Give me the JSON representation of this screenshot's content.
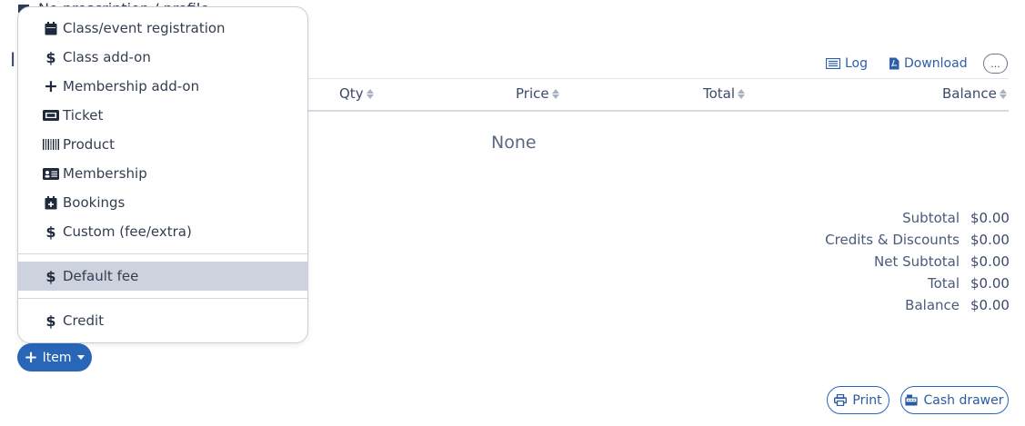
{
  "page": {
    "partial_top_text": "No prescription / profile",
    "heading_partial": "I",
    "links": {
      "log": "Log",
      "download": "Download",
      "more": "..."
    },
    "table": {
      "columns": [
        "Qty",
        "Price",
        "Total",
        "Balance"
      ],
      "empty_text": "None"
    },
    "summary": [
      {
        "label": "Subtotal",
        "value": "$0.00"
      },
      {
        "label": "Credits & Discounts",
        "value": "$0.00"
      },
      {
        "label": "Net Subtotal",
        "value": "$0.00"
      },
      {
        "label": "Total",
        "value": "$0.00"
      },
      {
        "label": "Balance",
        "value": "$0.00"
      }
    ],
    "item_button": "Item",
    "print_button": "Print",
    "cash_drawer_button": "Cash drawer"
  },
  "menu": {
    "items": [
      {
        "label": "Class/event registration",
        "icon": "calendar-icon"
      },
      {
        "label": "Class add-on",
        "icon": "dollar-icon"
      },
      {
        "label": "Membership add-on",
        "icon": "plus-icon"
      },
      {
        "label": "Ticket",
        "icon": "ticket-icon"
      },
      {
        "label": "Product",
        "icon": "barcode-icon"
      },
      {
        "label": "Membership",
        "icon": "id-card-icon"
      },
      {
        "label": "Bookings",
        "icon": "calendar-plus-icon"
      },
      {
        "label": "Custom (fee/extra)",
        "icon": "dollar-icon"
      },
      {
        "label": "Default fee",
        "icon": "dollar-icon",
        "active": true
      },
      {
        "label": "Credit",
        "icon": "dollar-icon"
      }
    ]
  },
  "colors": {
    "primary": "#2a66b8",
    "text": "#3c4a6b",
    "active_item_bg": "#cdd2de"
  }
}
